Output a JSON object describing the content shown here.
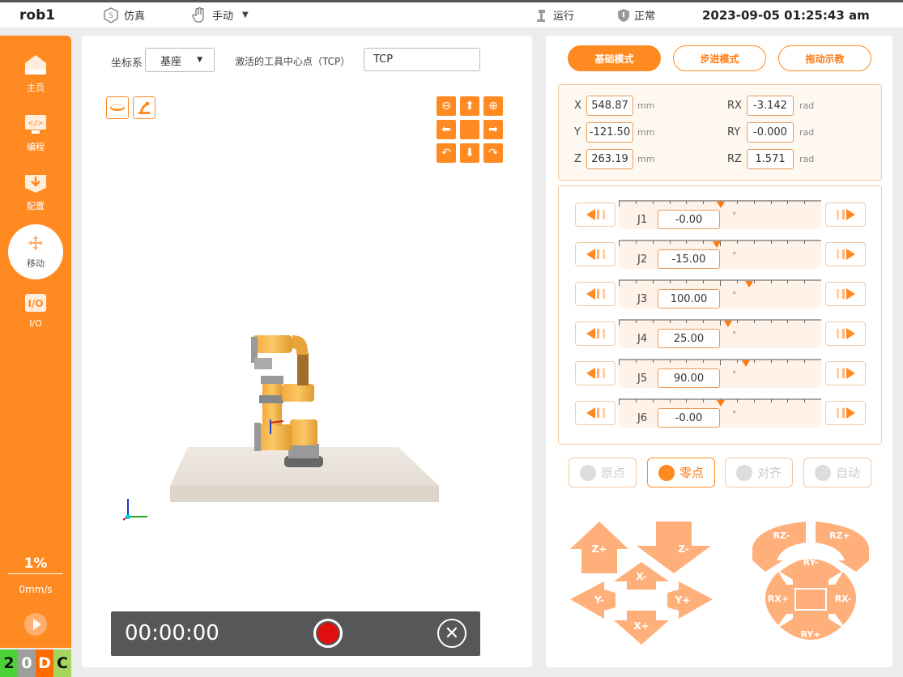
{
  "topbar": {
    "robot": "rob1",
    "sim": "仿真",
    "manual": "手动",
    "run": "运行",
    "state": "正常",
    "datetime": "2023-09-05 01:25:43 am"
  },
  "sidebar": {
    "items": [
      {
        "label": "主页"
      },
      {
        "label": "编程"
      },
      {
        "label": "配置"
      },
      {
        "label": "移动"
      },
      {
        "label": "I/O"
      }
    ],
    "speed_pct": "1%",
    "speed": "0mm/s",
    "status": [
      "2",
      "0",
      "D",
      "C"
    ]
  },
  "view": {
    "coord_label": "坐标系",
    "coord_value": "基座",
    "tcp_label": "激活的工具中心点（TCP）",
    "tcp_value": "TCP",
    "timer": "00:00:00"
  },
  "modes": [
    "基础模式",
    "步进模式",
    "拖动示教"
  ],
  "pose": [
    {
      "axis": "X",
      "value": "548.87",
      "unit": "mm"
    },
    {
      "axis": "Y",
      "value": "-121.50",
      "unit": "mm"
    },
    {
      "axis": "Z",
      "value": "263.19",
      "unit": "mm"
    },
    {
      "axis": "RX",
      "value": "-3.142",
      "unit": "rad"
    },
    {
      "axis": "RY",
      "value": "-0.000",
      "unit": "rad"
    },
    {
      "axis": "RZ",
      "value": "1.571",
      "unit": "rad"
    }
  ],
  "joints": [
    {
      "name": "J1",
      "value": "-0.00",
      "unit": "°",
      "pos": 0.5
    },
    {
      "name": "J2",
      "value": "-15.00",
      "unit": "°",
      "pos": 0.48
    },
    {
      "name": "J3",
      "value": "100.00",
      "unit": "°",
      "pos": 0.64
    },
    {
      "name": "J4",
      "value": "25.00",
      "unit": "°",
      "pos": 0.535
    },
    {
      "name": "J5",
      "value": "90.00",
      "unit": "°",
      "pos": 0.625
    },
    {
      "name": "J6",
      "value": "-0.00",
      "unit": "°",
      "pos": 0.5
    }
  ],
  "actions": [
    "原点",
    "零点",
    "对齐",
    "自动"
  ],
  "jog_linear": {
    "zp": "Z+",
    "zm": "Z-",
    "xm": "X-",
    "ym": "Y-",
    "yp": "Y+",
    "xp": "X+"
  },
  "jog_rot": {
    "rzm": "RZ-",
    "rzp": "RZ+",
    "rym": "RY-",
    "rxp": "RX+",
    "rxm": "RX-",
    "ryp": "RY+"
  }
}
